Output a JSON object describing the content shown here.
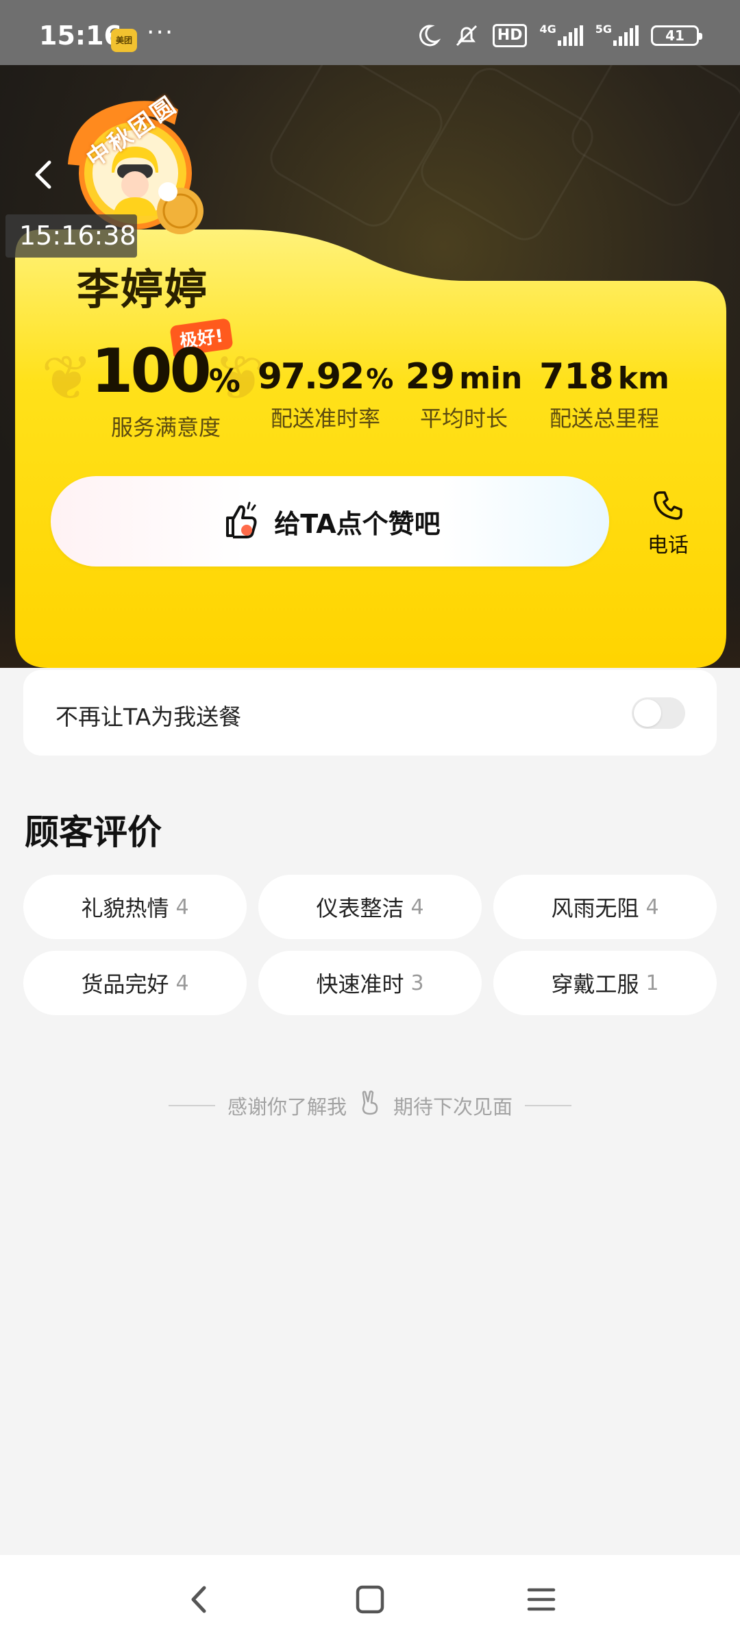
{
  "status_bar": {
    "time": "15:16",
    "app_badge": "美团",
    "more": "···",
    "network_hd": "HD",
    "net_4g": "4G",
    "net_5g": "5G",
    "battery": "41"
  },
  "timestamp_overlay": "15:16:38",
  "badge": {
    "arc_text": "中秋团圆"
  },
  "rider": {
    "name": "李婷婷"
  },
  "stats": [
    {
      "value": "100",
      "unit": "%",
      "label": "服务满意度",
      "tag": "极好!"
    },
    {
      "value": "97.92",
      "unit": "%",
      "label": "配送准时率"
    },
    {
      "value": "29",
      "unit": "min",
      "label": "平均时长"
    },
    {
      "value": "718",
      "unit": "km",
      "label": "配送总里程"
    }
  ],
  "like_button": {
    "label": "给TA点个赞吧"
  },
  "phone": {
    "label": "电话"
  },
  "block_setting": {
    "label": "不再让TA为我送餐",
    "enabled": false
  },
  "reviews": {
    "title": "顾客评价",
    "tags": [
      {
        "label": "礼貌热情",
        "count": "4"
      },
      {
        "label": "仪表整洁",
        "count": "4"
      },
      {
        "label": "风雨无阻",
        "count": "4"
      },
      {
        "label": "货品完好",
        "count": "4"
      },
      {
        "label": "快速准时",
        "count": "3"
      },
      {
        "label": "穿戴工服",
        "count": "1"
      }
    ]
  },
  "footer": {
    "left": "感谢你了解我",
    "right": "期待下次见面"
  },
  "colors": {
    "card_yellow": "#ffe11a",
    "accent_orange": "#ff5a1d",
    "page_bg": "#f4f4f4"
  }
}
